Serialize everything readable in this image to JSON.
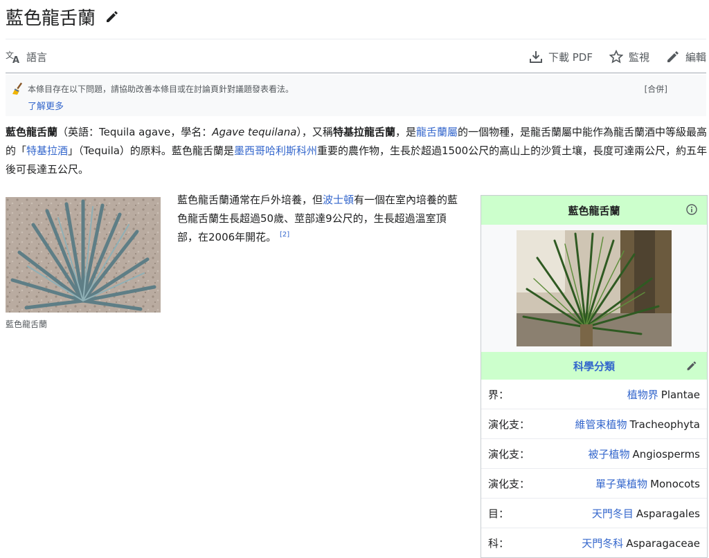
{
  "page": {
    "title": "藍色龍舌蘭"
  },
  "toolbar": {
    "language_label": "語言",
    "download_label": "下載 PDF",
    "watch_label": "監視",
    "edit_label": "編輯"
  },
  "notice": {
    "text": "本條目存在以下問題，請協助改善本條目或在討論頁針對議題發表看法。",
    "merge_label": "[合併]",
    "learn_more": "了解更多"
  },
  "lead": {
    "name_bold": "藍色龍舌蘭",
    "p1": "（英語：Tequila agave，學名：",
    "sci_name": "Agave tequilana",
    "p2": "），又稱",
    "alt_name_bold": "特基拉龍舌蘭",
    "p3": "，是",
    "link_genus": "龍舌蘭屬",
    "p4": "的一個物種，是龍舌蘭屬中能作為龍舌蘭酒中等級最高的「",
    "link_tequila": "特基拉酒",
    "p5": "」（Tequila）的原料。藍色龍舌蘭是",
    "link_jalisco": "墨西哥哈利斯科州",
    "p6": "重要的農作物，生長於超過1500公尺的高山上的沙質土壤，長度可達兩公尺，約五年後可長達五公尺。"
  },
  "thumb": {
    "caption": "藍色龍舌蘭"
  },
  "para2": {
    "t1": "藍色龍舌蘭通常在戶外培養，但",
    "link_boston": "波士頓",
    "t2": "有一個在室內培養的藍色龍舌蘭生長超過50歲、莖部達9公尺的，生長超過溫室頂部，在2006年開花。",
    "ref": "[2]"
  },
  "infobox": {
    "title": "藍色龍舌蘭",
    "section_label": "科學分類",
    "rows": [
      {
        "rank": "界：",
        "link": "植物界",
        "latin": "Plantae"
      },
      {
        "rank": "演化支：",
        "link": "維管束植物",
        "latin": "Tracheophyta"
      },
      {
        "rank": "演化支：",
        "link": "被子植物",
        "latin": "Angiosperms"
      },
      {
        "rank": "演化支：",
        "link": "單子葉植物",
        "latin": "Monocots"
      },
      {
        "rank": "目：",
        "link": "天門冬目",
        "latin": "Asparagales"
      },
      {
        "rank": "科：",
        "link": "天門冬科",
        "latin": "Asparagaceae"
      }
    ]
  },
  "icons": {
    "title_edit": "pencil-icon",
    "language": "translate-icon",
    "download": "download-icon",
    "watch": "star-icon",
    "edit": "pencil-icon",
    "notice": "broom-icon",
    "infobox_info": "info-icon",
    "section_edit": "pencil-icon"
  },
  "colors": {
    "link": "#3366cc",
    "infobox_header": "#ccffcc",
    "text": "#202122"
  }
}
